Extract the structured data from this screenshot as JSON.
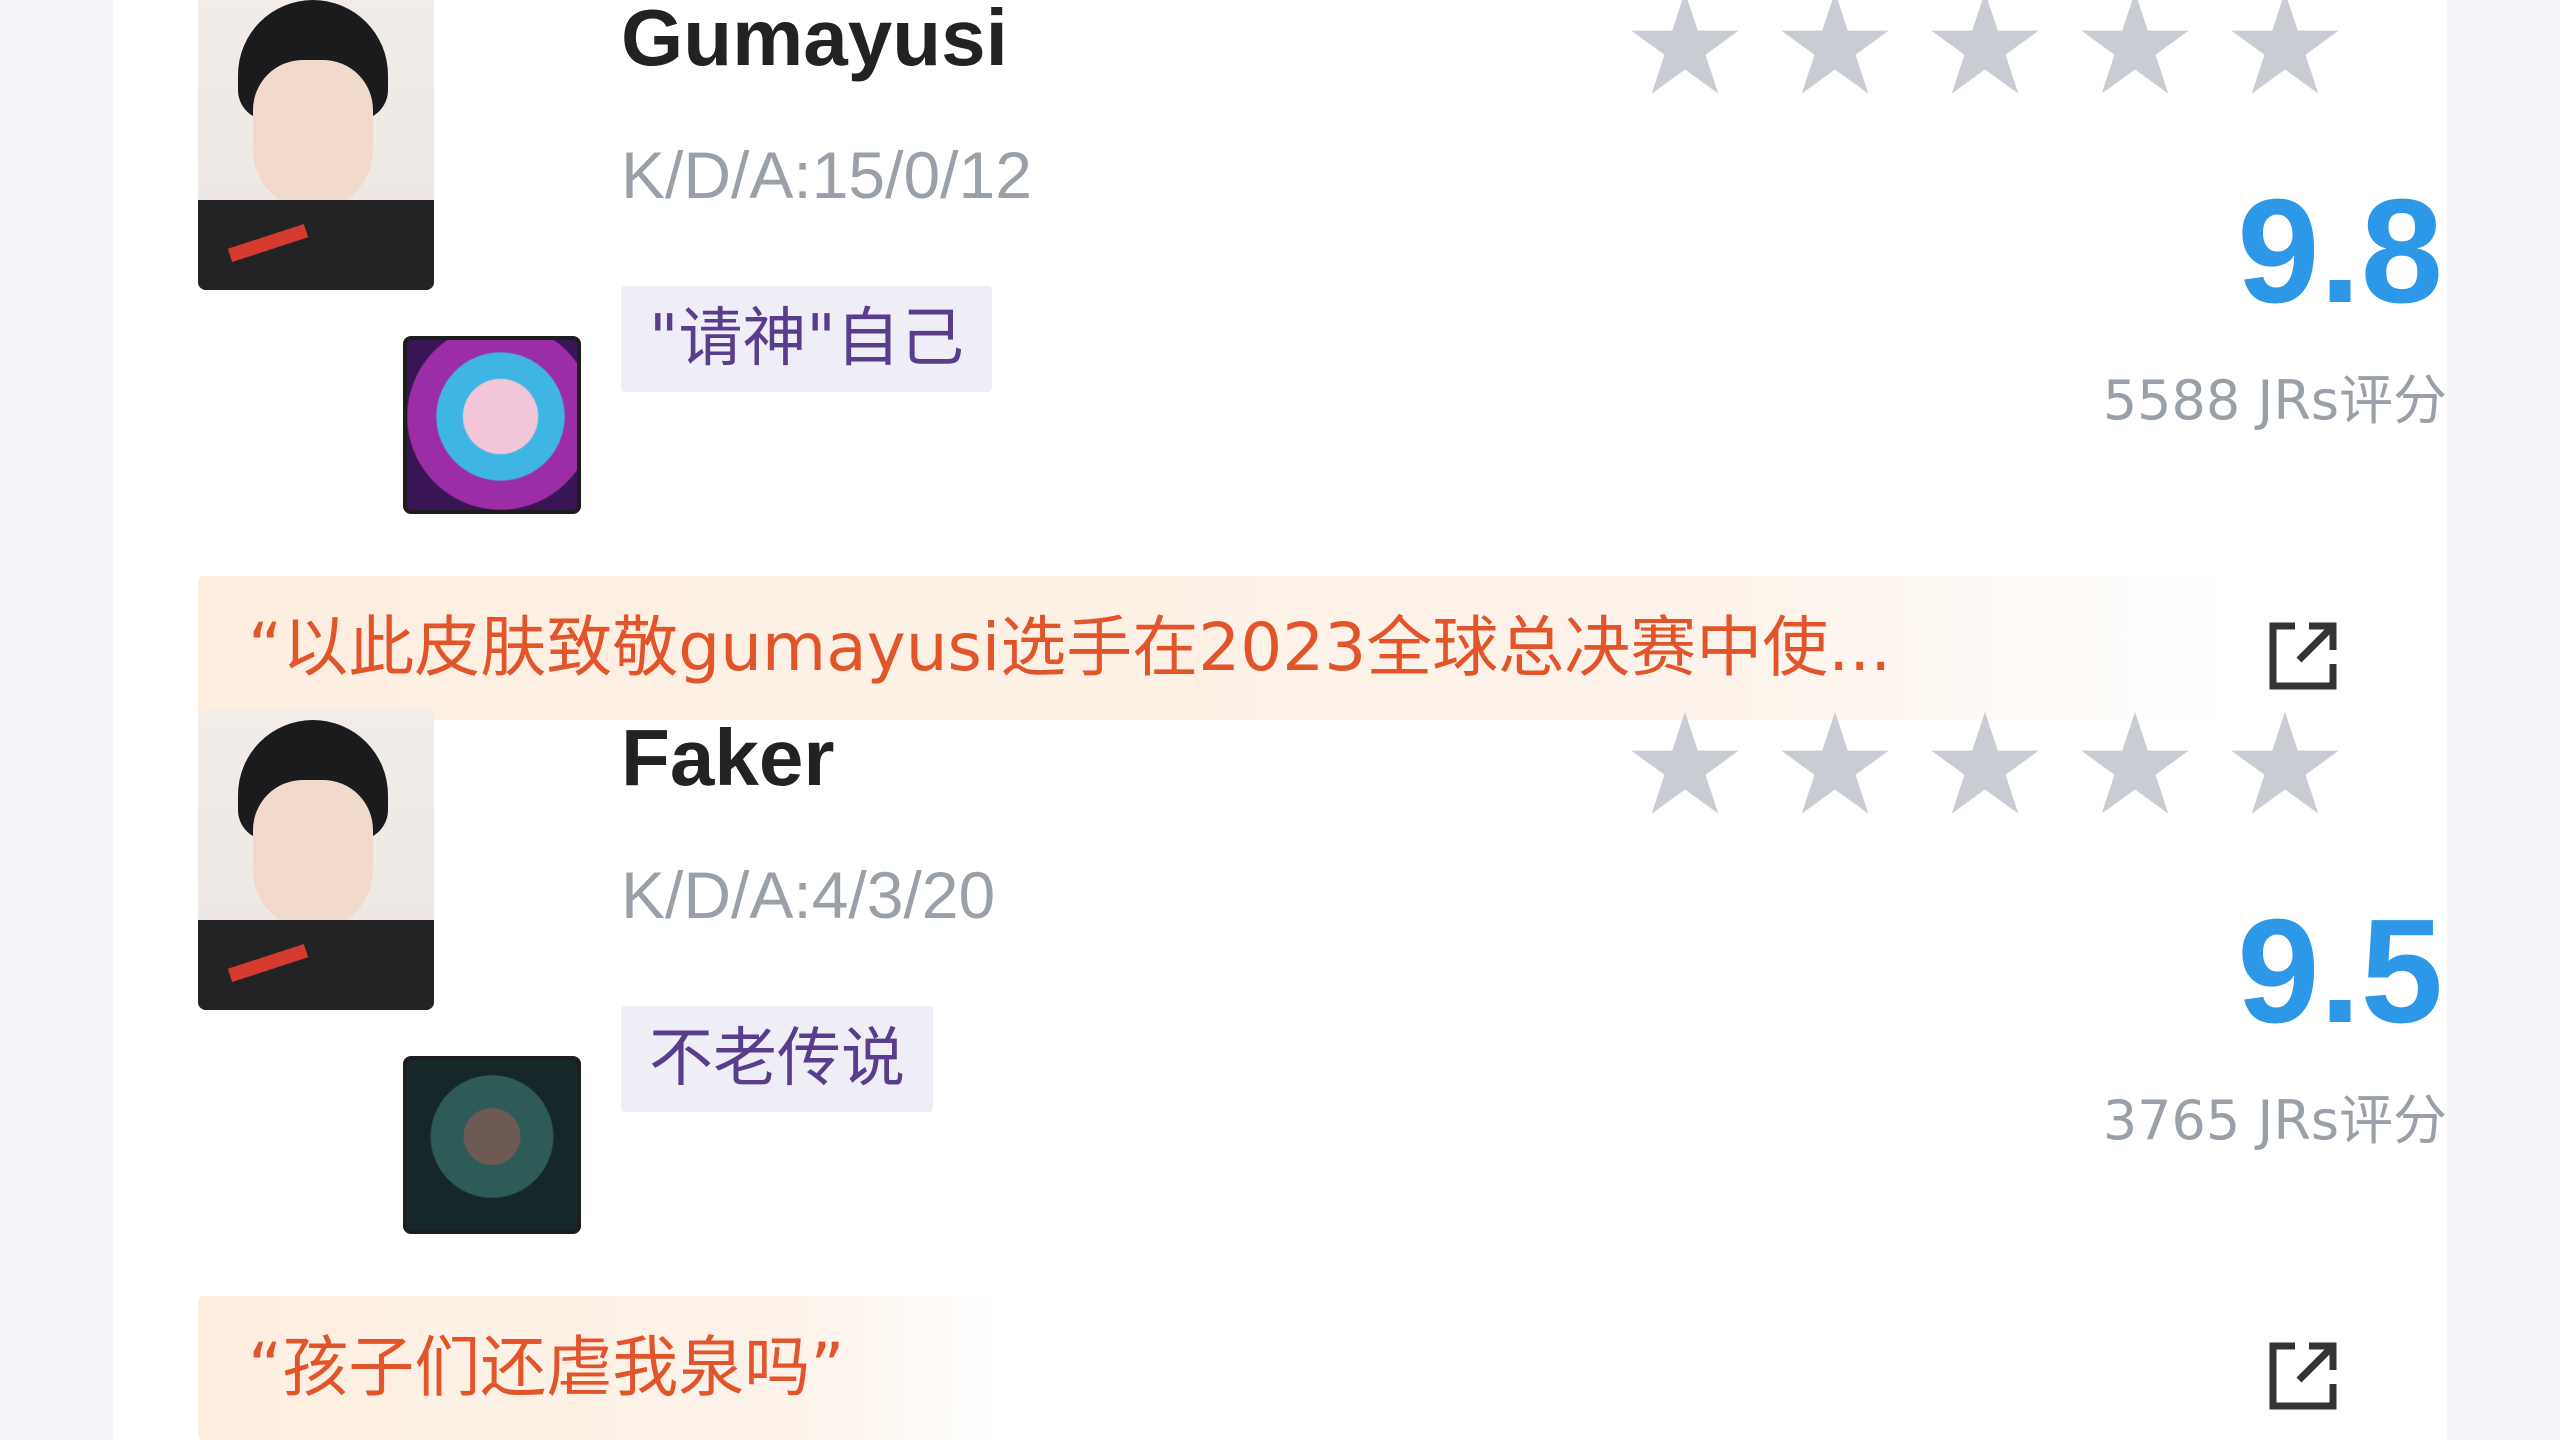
{
  "players": [
    {
      "name": "Gumayusi",
      "kda": "K/D/A:15/0/12",
      "tag": "\"请神\"自己",
      "rating_stars": 5,
      "score": "9.8",
      "votes": "5588 JRs评分",
      "quote": "“以此皮肤致敬gumayusi选手在2023全球总决赛中使...",
      "champion_icon": "jinx-portrait",
      "share_icon": "share-icon"
    },
    {
      "name": "Faker",
      "kda": "K/D/A:4/3/20",
      "tag": "不老传说",
      "rating_stars": 5,
      "score": "9.5",
      "votes": "3765 JRs评分",
      "quote": "“孩子们还虐我泉吗”",
      "champion_icon": "sylas-portrait",
      "share_icon": "share-icon"
    }
  ],
  "colors": {
    "score": "#2d97e8",
    "quote_text": "#e2552a",
    "tag_text": "#5a3c8c",
    "star_empty": "#c9ccd3"
  }
}
